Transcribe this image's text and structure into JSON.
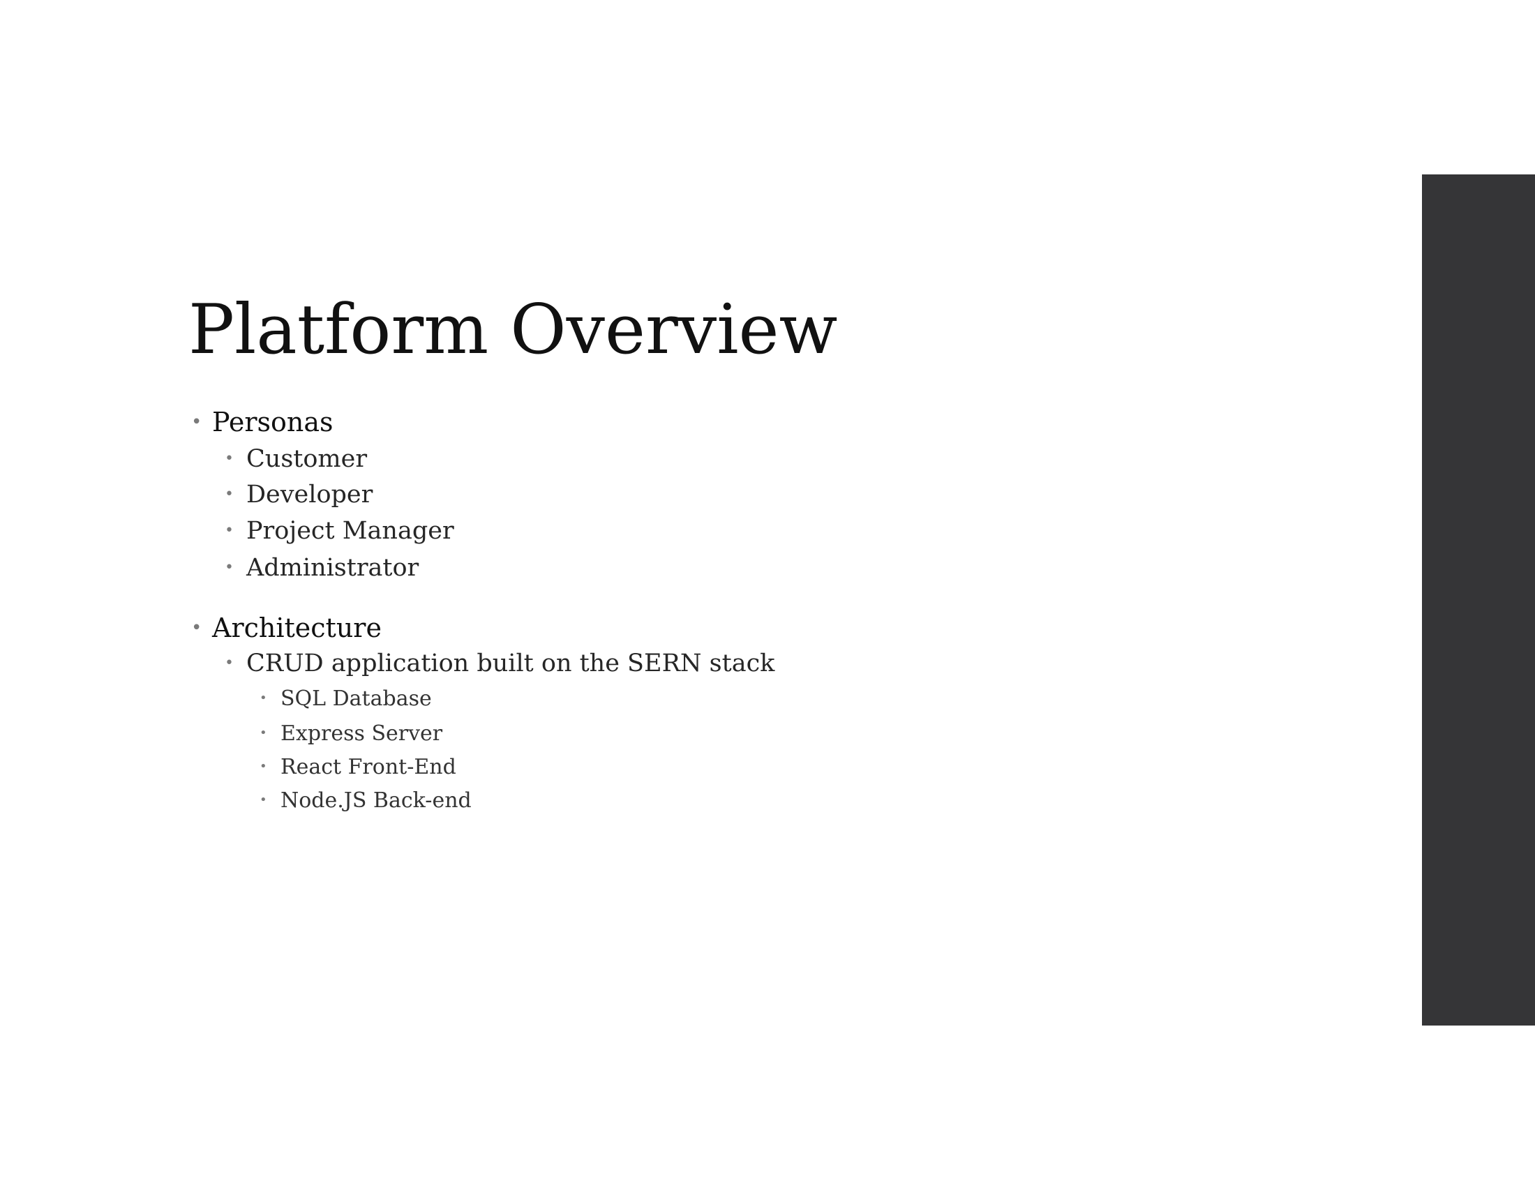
{
  "slide": {
    "title": "Platform Overview",
    "sections": [
      {
        "label": "Personas",
        "items": [
          "Customer",
          "Developer",
          "Project Manager",
          "Administrator"
        ]
      },
      {
        "label": "Architecture",
        "items": [
          {
            "label": "CRUD application built on the SERN stack",
            "items": [
              "SQL Database",
              "Express Server",
              "React Front-End",
              "Node.JS Back-end"
            ]
          }
        ]
      }
    ]
  },
  "theme": {
    "accent_bar_color": "#353537",
    "bullet_symbol": "•"
  }
}
